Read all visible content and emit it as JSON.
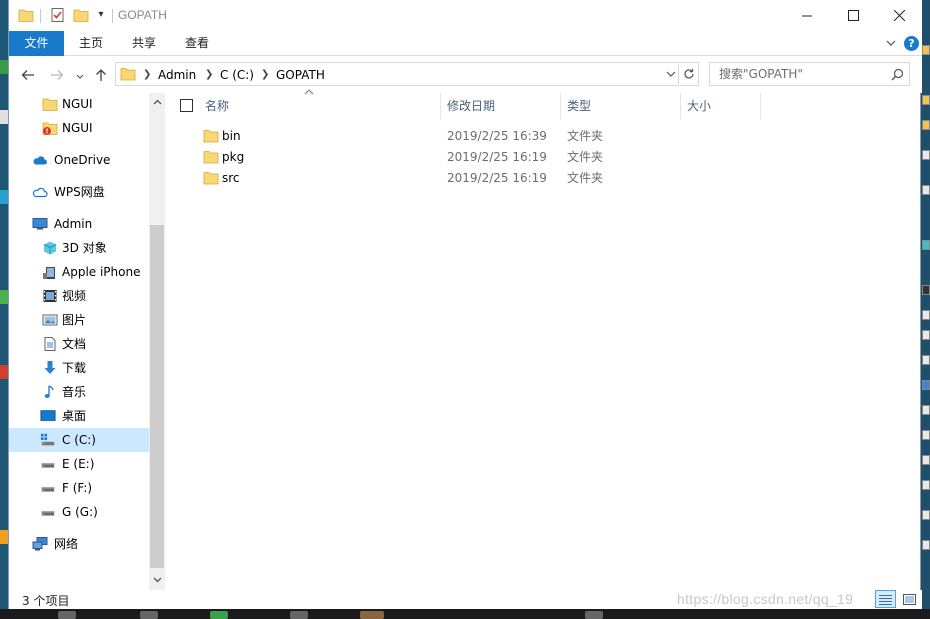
{
  "window": {
    "title": "GOPATH"
  },
  "ribbon": {
    "tabs": [
      "文件",
      "主页",
      "共享",
      "查看"
    ]
  },
  "address": {
    "crumbs": [
      "Admin",
      "C (C:)",
      "GOPATH"
    ],
    "search_placeholder": "搜索\"GOPATH\""
  },
  "sidebar": {
    "items": [
      {
        "label": "NGUI",
        "icon": "folder-icon"
      },
      {
        "label": "NGUI",
        "icon": "folder-warning-icon"
      },
      {
        "label": "OneDrive",
        "icon": "onedrive-cloud-icon"
      },
      {
        "label": "WPS网盘",
        "icon": "wps-cloud-icon"
      },
      {
        "label": "Admin",
        "icon": "computer-icon"
      },
      {
        "label": "3D 对象",
        "icon": "3d-objects-icon"
      },
      {
        "label": "Apple iPhone",
        "icon": "iphone-icon"
      },
      {
        "label": "视频",
        "icon": "video-icon"
      },
      {
        "label": "图片",
        "icon": "pictures-icon"
      },
      {
        "label": "文档",
        "icon": "documents-icon"
      },
      {
        "label": "下载",
        "icon": "download-icon"
      },
      {
        "label": "音乐",
        "icon": "music-icon"
      },
      {
        "label": "桌面",
        "icon": "desktop-icon"
      },
      {
        "label": "C (C:)",
        "icon": "windows-drive-icon",
        "selected": true
      },
      {
        "label": "E (E:)",
        "icon": "drive-icon"
      },
      {
        "label": "F (F:)",
        "icon": "drive-icon"
      },
      {
        "label": "G (G:)",
        "icon": "drive-icon"
      },
      {
        "label": "网络",
        "icon": "network-icon"
      }
    ]
  },
  "columns": [
    "名称",
    "修改日期",
    "类型",
    "大小"
  ],
  "files": [
    {
      "name": "bin",
      "date": "2019/2/25 16:39",
      "type": "文件夹",
      "size": ""
    },
    {
      "name": "pkg",
      "date": "2019/2/25 16:19",
      "type": "文件夹",
      "size": ""
    },
    {
      "name": "src",
      "date": "2019/2/25 16:19",
      "type": "文件夹",
      "size": ""
    }
  ],
  "status": {
    "count": "3 个项目",
    "watermark": "https://blog.csdn.net/qq_19"
  },
  "colors": {
    "accent": "#1979ca",
    "selection": "#cce8ff",
    "folder": "#f8d775",
    "header_text": "#4c607a"
  }
}
